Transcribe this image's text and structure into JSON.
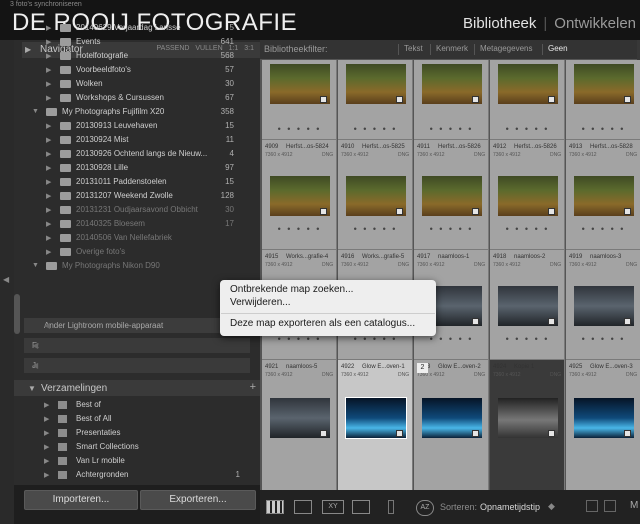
{
  "app": {
    "sync_status": "3 foto's synchroniseren",
    "brand": "DE ROOIJ FOTOGRAFIE",
    "modules": [
      "Bibliotheek",
      "Ontwikkelen"
    ]
  },
  "navigator": {
    "title": "Navigator",
    "zoom_options": [
      "PASSEND",
      "VULLEN",
      "1:1",
      "3:1"
    ]
  },
  "folders": [
    {
      "name": "20140629 Verjaardag Larisse",
      "count": "5",
      "level": 1,
      "dim": false
    },
    {
      "name": "Events",
      "count": "641",
      "level": 1,
      "dim": false
    },
    {
      "name": "Hotelfotografie",
      "count": "568",
      "level": 1,
      "dim": false
    },
    {
      "name": "Voorbeeldfoto's",
      "count": "57",
      "level": 1,
      "dim": false
    },
    {
      "name": "Wolken",
      "count": "30",
      "level": 1,
      "dim": false
    },
    {
      "name": "Workshops & Cursussen",
      "count": "67",
      "level": 1,
      "dim": false
    },
    {
      "name": "My Photographs Fujifilm X20",
      "count": "358",
      "level": 0,
      "dim": false
    },
    {
      "name": "20130913 Leuvehaven",
      "count": "15",
      "level": 1,
      "dim": false
    },
    {
      "name": "20130924 Mist",
      "count": "11",
      "level": 1,
      "dim": false
    },
    {
      "name": "20130926 Ochtend langs de Nieuw...",
      "count": "4",
      "level": 1,
      "dim": false
    },
    {
      "name": "20130928 Lille",
      "count": "97",
      "level": 1,
      "dim": false
    },
    {
      "name": "20131011 Paddenstoelen",
      "count": "15",
      "level": 1,
      "dim": false
    },
    {
      "name": "20131207 Weekend Zwolle",
      "count": "128",
      "level": 1,
      "dim": false
    },
    {
      "name": "20131231 Oudjaarsavond Obbicht",
      "count": "30",
      "level": 1,
      "dim": true
    },
    {
      "name": "20140325 Bloesem",
      "count": "17",
      "level": 1,
      "dim": true
    },
    {
      "name": "20140506 Van Nellefabriek",
      "count": "",
      "level": 1,
      "dim": true
    },
    {
      "name": "Overige foto's",
      "count": "",
      "level": 1,
      "dim": true
    },
    {
      "name": "My Photographs Nikon D90",
      "count": "",
      "level": 0,
      "dim": true
    }
  ],
  "mobile_volume": "Ander Lightroom mobile-apparaat",
  "drives": [
    "F:",
    "J:"
  ],
  "collections": {
    "title": "Verzamelingen",
    "items": [
      {
        "name": "Best of",
        "count": ""
      },
      {
        "name": "Best of All",
        "count": ""
      },
      {
        "name": "Presentaties",
        "count": ""
      },
      {
        "name": "Smart Collections",
        "count": ""
      },
      {
        "name": "Van Lr mobile",
        "count": ""
      },
      {
        "name": "Achtergronden",
        "count": "1"
      }
    ]
  },
  "buttons": {
    "import": "Importeren...",
    "export": "Exporteren..."
  },
  "filterbar": {
    "label": "Bibliotheekfilter:",
    "options": [
      "Tekst",
      "Kenmerk",
      "Metagegevens",
      "Geen"
    ],
    "active": "Geen"
  },
  "grid": {
    "rows": [
      {
        "cells": [
          {
            "num": "4909",
            "name": "Herfst...os-5824",
            "dims": "7360 x 4912",
            "fmt": "DNG"
          },
          {
            "num": "4910",
            "name": "Herfst...os-5825",
            "dims": "7360 x 4912",
            "fmt": "DNG"
          },
          {
            "num": "4911",
            "name": "Herfst...os-5826",
            "dims": "7360 x 4912",
            "fmt": "DNG"
          },
          {
            "num": "4912",
            "name": "Herfst...os-5826",
            "dims": "7360 x 4912",
            "fmt": "DNG"
          },
          {
            "num": "4913",
            "name": "Herfst...os-5828",
            "dims": "7360 x 4912",
            "fmt": "DNG"
          }
        ]
      },
      {
        "cells": [
          {
            "num": "4915",
            "name": "Works...grafie-4",
            "dims": "7360 x 4912",
            "fmt": "DNG"
          },
          {
            "num": "4916",
            "name": "Works...grafie-5",
            "dims": "7360 x 4912",
            "fmt": "DNG"
          },
          {
            "num": "4917",
            "name": "naamloos-1",
            "dims": "7360 x 4912",
            "fmt": "DNG"
          },
          {
            "num": "4918",
            "name": "naamloos-2",
            "dims": "7360 x 4912",
            "fmt": "DNG"
          },
          {
            "num": "4919",
            "name": "naamloos-3",
            "dims": "7360 x 4912",
            "fmt": "DNG"
          }
        ]
      },
      {
        "cells": [
          {
            "num": "4921",
            "name": "naamloos-5",
            "dims": "7360 x 4912",
            "fmt": "DNG"
          },
          {
            "num": "4922",
            "name": "Glow E...oven-1",
            "dims": "7360 x 4912",
            "fmt": "DNG"
          },
          {
            "num": "4923",
            "name": "Glow E...oven-2",
            "dims": "7360 x 4912",
            "fmt": "DNG"
          },
          {
            "num": "4924",
            "name": "Kopie 1",
            "dims": "7360 x 4912",
            "fmt": "DNG"
          },
          {
            "num": "4925",
            "name": "Glow E...oven-3",
            "dims": "7360 x 4912",
            "fmt": "DNG"
          }
        ]
      }
    ],
    "stack_badge": "2"
  },
  "context_menu": {
    "items": [
      "Ontbrekende map zoeken...",
      "Verwijderen...",
      "Deze map exporteren als een catalogus..."
    ]
  },
  "toolbar": {
    "sort_label": "Sorteren:",
    "sort_value": "Opnametijdstip"
  },
  "colors": {
    "background": "#2c2c2c",
    "grid": "#a3a3a3",
    "selected_cell": "#c7c7c7",
    "autumn_thumb": "#6f5a2c",
    "glow_thumb": "#1f6fb3"
  }
}
